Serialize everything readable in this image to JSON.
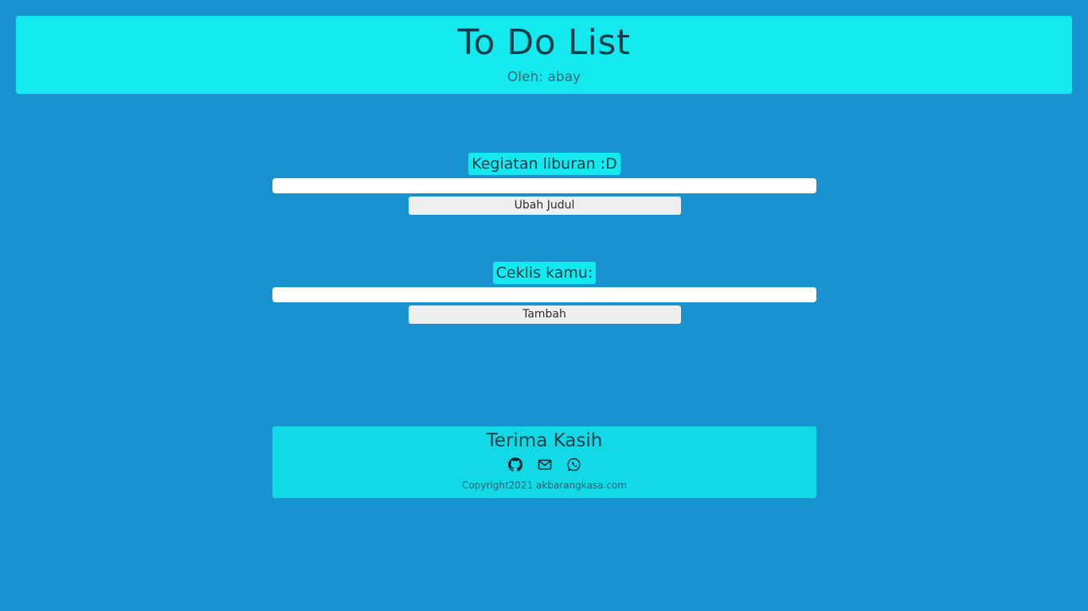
{
  "header": {
    "title": "To Do List",
    "byline": "Oleh: abay"
  },
  "title_section": {
    "label": "Kegiatan liburan :D",
    "input_value": "",
    "button_label": "Ubah Judul"
  },
  "todo_section": {
    "label": "Ceklis kamu:",
    "input_value": "",
    "button_label": "Tambah"
  },
  "footer": {
    "thanks": "Terima Kasih",
    "icons": [
      "github-icon",
      "mail-icon",
      "whatsapp-icon"
    ],
    "copyright": "Copyright2021 akbarangkasa.com"
  },
  "colors": {
    "background": "#1993cf",
    "accent": "#14e9f0",
    "footer": "#13d9e6",
    "text": "#0b3d4a"
  }
}
